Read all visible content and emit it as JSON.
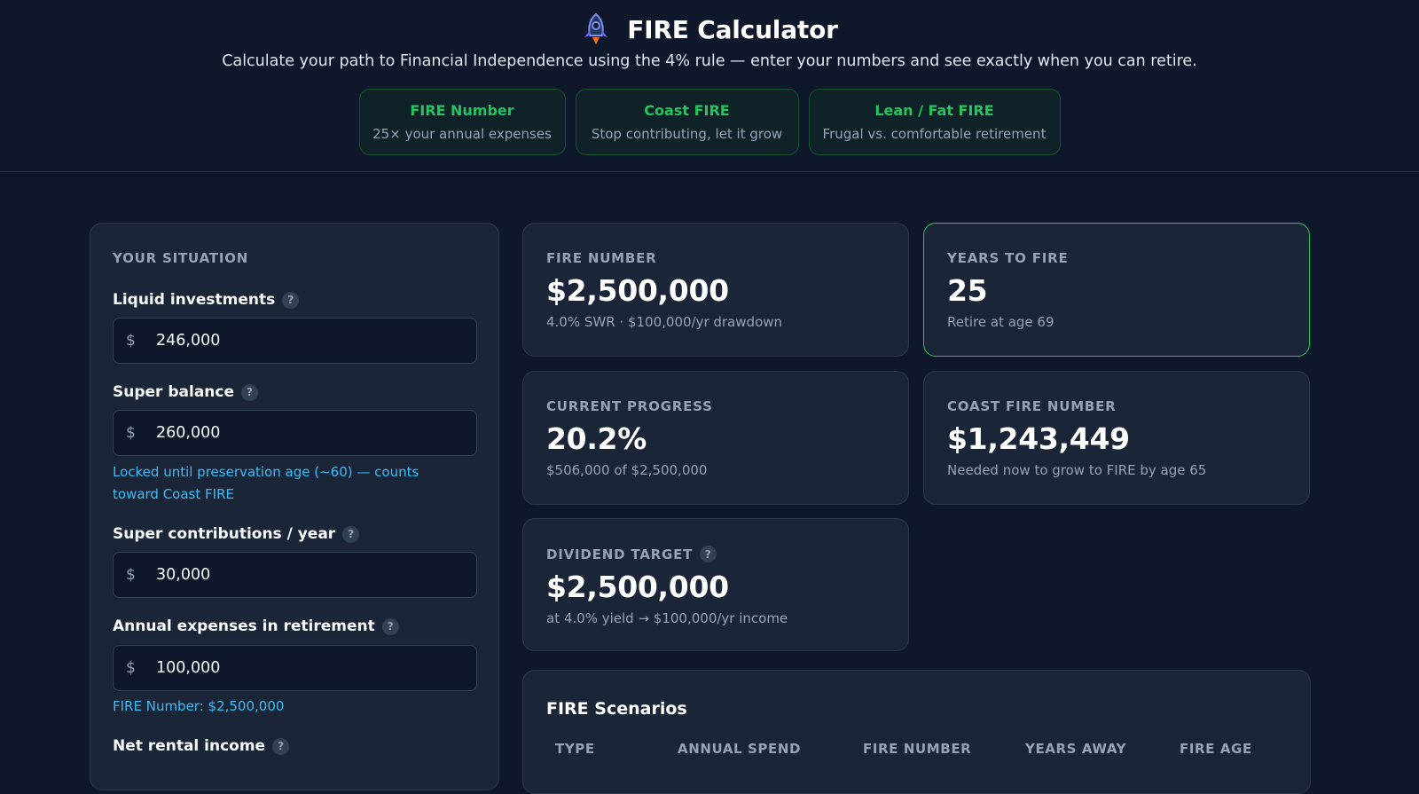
{
  "header": {
    "title": "FIRE Calculator",
    "subtitle": "Calculate your path to Financial Independence using the 4% rule — enter your numbers and see exactly when you can retire.",
    "pills": [
      {
        "title": "FIRE Number",
        "desc": "25× your annual expenses"
      },
      {
        "title": "Coast FIRE",
        "desc": "Stop contributing, let it grow"
      },
      {
        "title": "Lean / Fat FIRE",
        "desc": "Frugal vs. comfortable retirement"
      }
    ]
  },
  "form": {
    "section_label": "YOUR SITUATION",
    "currency_symbol": "$",
    "help_symbol": "?",
    "fields": [
      {
        "label": "Liquid investments",
        "value": "246,000"
      },
      {
        "label": "Super balance",
        "value": "260,000",
        "hint": "Locked until preservation age (~60) — counts toward Coast FIRE"
      },
      {
        "label": "Super contributions / year",
        "value": "30,000"
      },
      {
        "label": "Annual expenses in retirement",
        "value": "100,000",
        "hint": "FIRE Number: $2,500,000"
      },
      {
        "label": "Net rental income"
      }
    ]
  },
  "results": {
    "fire_number": {
      "label": "FIRE NUMBER",
      "value": "$2,500,000",
      "sub": "4.0% SWR · $100,000/yr drawdown"
    },
    "years_to_fire": {
      "label": "YEARS TO FIRE",
      "value": "25",
      "sub": "Retire at age 69"
    },
    "current_progress": {
      "label": "CURRENT PROGRESS",
      "value": "20.2%",
      "sub": "$506,000 of $2,500,000"
    },
    "coast_fire": {
      "label": "COAST FIRE NUMBER",
      "value": "$1,243,449",
      "sub": "Needed now to grow to FIRE by age 65"
    },
    "dividend_target": {
      "label": "DIVIDEND TARGET",
      "value": "$2,500,000",
      "sub": "at 4.0% yield → $100,000/yr income"
    }
  },
  "scenarios": {
    "title": "FIRE Scenarios",
    "columns": [
      "TYPE",
      "ANNUAL SPEND",
      "FIRE NUMBER",
      "YEARS AWAY",
      "FIRE AGE"
    ]
  },
  "colors": {
    "accent_green": "#22c55e",
    "hint_blue": "#38bdf8",
    "background": "#0f172a",
    "panel": "#1b2538"
  }
}
